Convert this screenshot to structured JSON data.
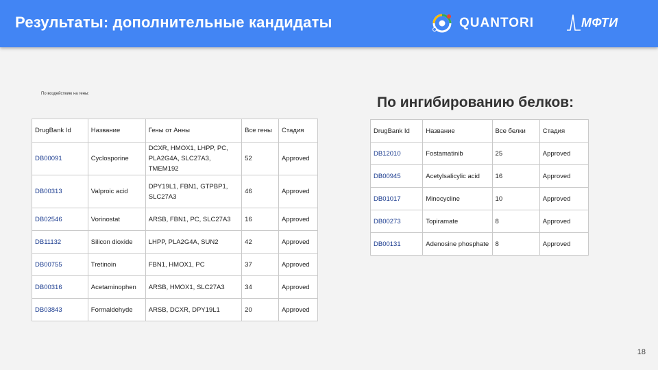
{
  "header": {
    "title": "Результаты: дополнительные кандидаты",
    "logo_quantori": "QUANTORI",
    "logo_mfti": "МФТИ",
    "color": "#4285f4"
  },
  "left": {
    "caption": "По воздействию на гены:",
    "columns": [
      "DrugBank Id",
      "Название",
      "Гены от Анны",
      "Все гены",
      "Стадия"
    ],
    "rows": [
      {
        "id": "DB00091",
        "name": "Cyclosporine",
        "genes": "DCXR, HMOX1, LHPP, PC, PLA2G4A, SLC27A3, TMEM192",
        "all": "52",
        "stage": "Approved"
      },
      {
        "id": "DB00313",
        "name": "Valproic acid",
        "genes": "DPY19L1, FBN1, GTPBP1, SLC27A3",
        "all": "46",
        "stage": "Approved"
      },
      {
        "id": "DB02546",
        "name": "Vorinostat",
        "genes": "ARSB, FBN1, PC, SLC27A3",
        "all": "16",
        "stage": "Approved"
      },
      {
        "id": "DB11132",
        "name": "Silicon dioxide",
        "genes": "LHPP, PLA2G4A, SUN2",
        "all": "42",
        "stage": "Approved"
      },
      {
        "id": "DB00755",
        "name": "Tretinoin",
        "genes": "FBN1, HMOX1, PC",
        "all": "37",
        "stage": "Approved"
      },
      {
        "id": "DB00316",
        "name": "Acetaminophen",
        "genes": "ARSB, HMOX1, SLC27A3",
        "all": "34",
        "stage": "Approved"
      },
      {
        "id": "DB03843",
        "name": "Formaldehyde",
        "genes": "ARSB, DCXR, DPY19L1",
        "all": "20",
        "stage": "Approved"
      }
    ]
  },
  "right": {
    "heading": "По ингибированию белков:",
    "columns": [
      "DrugBank Id",
      "Название",
      "Все белки",
      "Стадия"
    ],
    "rows": [
      {
        "id": "DB12010",
        "name": "Fostamatinib",
        "all": "25",
        "stage": "Approved"
      },
      {
        "id": "DB00945",
        "name": "Acetylsalicylic acid",
        "all": "16",
        "stage": "Approved"
      },
      {
        "id": "DB01017",
        "name": "Minocycline",
        "all": "10",
        "stage": "Approved"
      },
      {
        "id": "DB00273",
        "name": "Topiramate",
        "all": "8",
        "stage": "Approved"
      },
      {
        "id": "DB00131",
        "name": "Adenosine phosphate",
        "all": "8",
        "stage": "Approved"
      }
    ]
  },
  "page_number": "18"
}
